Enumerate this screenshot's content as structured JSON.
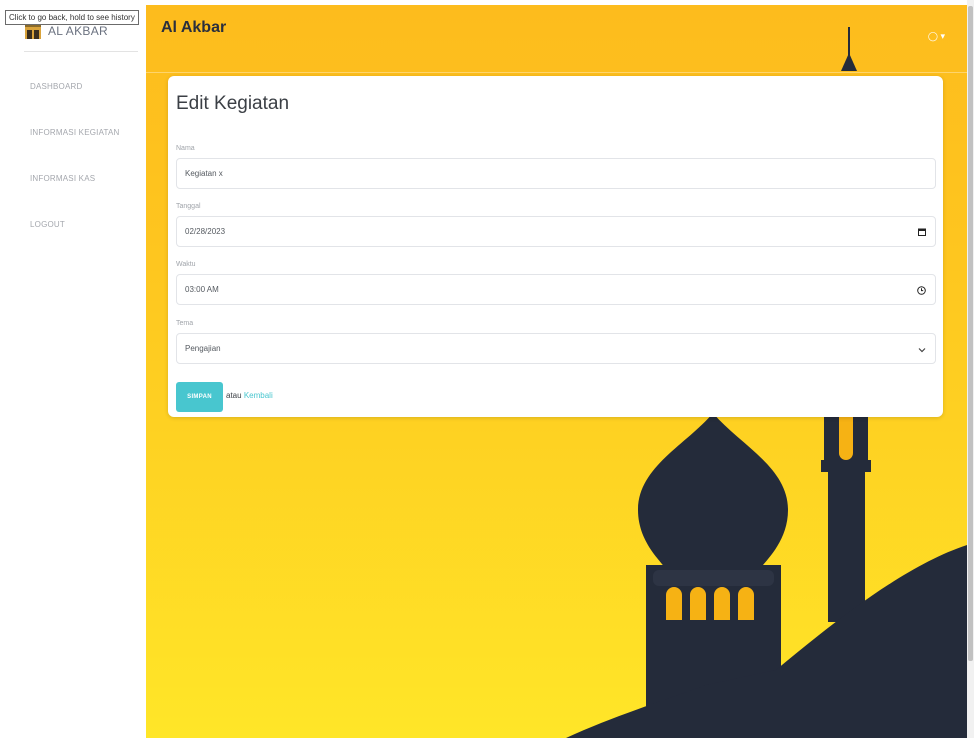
{
  "browser": {
    "back_tooltip": "Click to go back, hold to see history"
  },
  "sidebar": {
    "brand": "AL AKBAR",
    "items": [
      {
        "label": "DASHBOARD"
      },
      {
        "label": "INFORMASI KEGIATAN"
      },
      {
        "label": "INFORMASI KAS"
      },
      {
        "label": "LOGOUT"
      }
    ]
  },
  "header": {
    "title": "Al Akbar",
    "user_icon": "globe-icon",
    "user_caret": "▾"
  },
  "form": {
    "title": "Edit Kegiatan",
    "nama": {
      "label": "Nama",
      "value": "Kegiatan x"
    },
    "tanggal": {
      "label": "Tanggal",
      "value": "02/28/2023",
      "icon": "calendar-icon"
    },
    "waktu": {
      "label": "Waktu",
      "value": "03:00 AM",
      "icon": "clock-icon"
    },
    "tema": {
      "label": "Tema",
      "value": "Pengajian",
      "icon": "chevron-down-icon"
    },
    "save_label": "SIMPAN",
    "or_text": "atau",
    "back_label": "Kembali"
  },
  "colors": {
    "accent": "#48c6cf",
    "background_top": "#fdbc1d",
    "background_bottom": "#ffe628",
    "silhouette": "#242b3a",
    "window_glow": "#f6b214"
  }
}
